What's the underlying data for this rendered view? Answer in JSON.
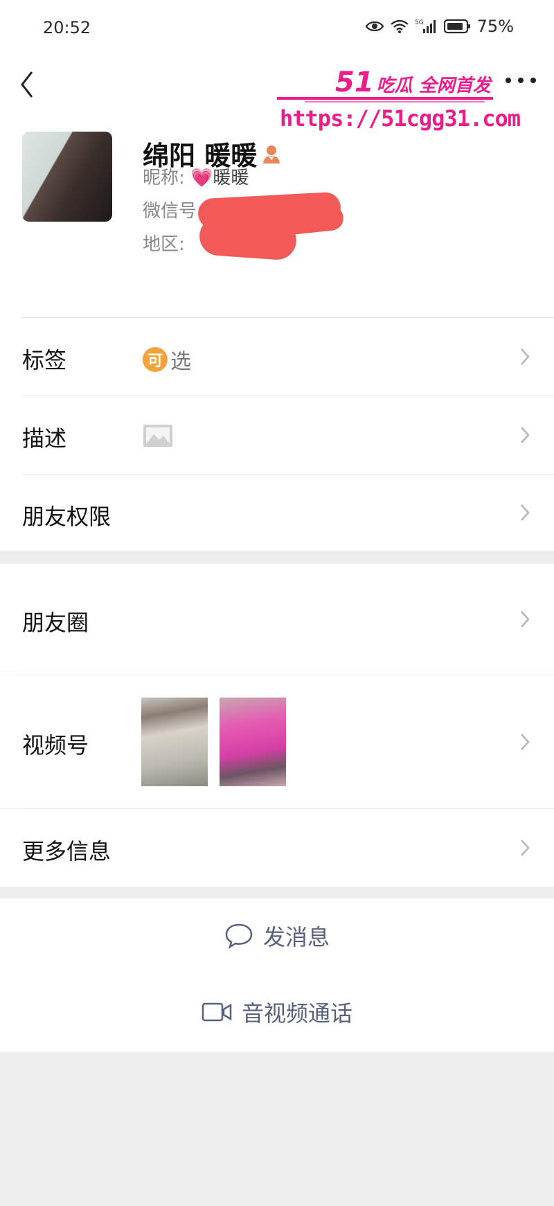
{
  "status_bar": {
    "time": "20:52",
    "battery": "75%"
  },
  "watermark": {
    "brand": "51",
    "brand_suffix": "吃瓜 全网首发",
    "url": "https://51cgg31.com"
  },
  "profile": {
    "name": "绵阳 暖暖",
    "nickname_label": "昵称:",
    "nickname_value": "💗暖暖",
    "wechat_label": "微信号:",
    "region_label": "地区:"
  },
  "cells": {
    "tags_label": "标签",
    "tags_badge": "可",
    "tags_text": "选",
    "description_label": "描述",
    "permissions_label": "朋友权限",
    "moments_label": "朋友圈",
    "channels_label": "视频号",
    "more_info_label": "更多信息"
  },
  "actions": {
    "send_message": "发消息",
    "video_call": "音视频通话"
  },
  "colors": {
    "accent_text": "#586080",
    "watermark": "#e91e8c",
    "redaction": "#f25a57",
    "tag_badge": "#f3a33b"
  }
}
